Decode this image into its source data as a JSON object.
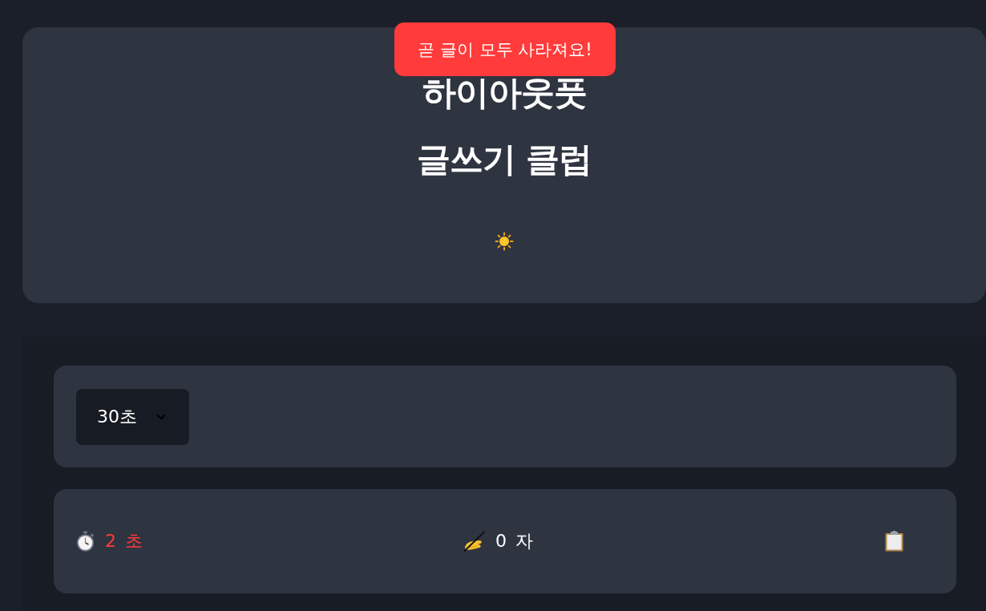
{
  "toast": {
    "message": "곧 글이 모두 사라져요!"
  },
  "header": {
    "title_lines": [
      "하이아웃풋",
      "글쓰기 클럽"
    ]
  },
  "settings": {
    "duration_select": {
      "value": "30초"
    }
  },
  "stats": {
    "timer": {
      "reading": "2 초",
      "warning": true
    },
    "char_count": {
      "reading": "0 자"
    }
  }
}
